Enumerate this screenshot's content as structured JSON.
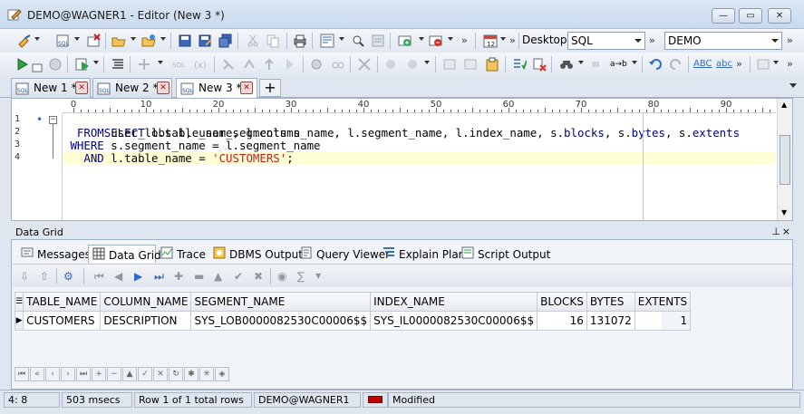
{
  "window": {
    "title": "DEMO@WAGNER1 - Editor (New 3 *)"
  },
  "toolbar": {
    "desktop_label": "Desktop:",
    "desktop_value": "SQL",
    "connection_value": "DEMO",
    "more": "»",
    "bullet": "•",
    "abc_upper": "ABC",
    "abc_lower": "abc",
    "ab": "a→b"
  },
  "tabs": [
    {
      "label": "New 1 *"
    },
    {
      "label": "New 2 *"
    },
    {
      "label": "New 3 *"
    }
  ],
  "add_tab": "+",
  "ruler": {
    "numbers": [
      "0",
      "10",
      "20",
      "30",
      "40",
      "50",
      "60",
      "70",
      "80",
      "90"
    ]
  },
  "editor": {
    "line_numbers": [
      "1",
      "2",
      "3",
      "4"
    ],
    "lines": [
      "SELECT l.table_name, l.column_name, l.segment_name, l.index_name, s.blocks, s.bytes, s.extents",
      "  FROM user_lobs l, user_segments s",
      " WHERE s.segment_name = l.segment_name",
      "   AND l.table_name = 'CUSTOMERS';"
    ]
  },
  "data_grid_panel": {
    "title": "Data Grid",
    "tabs": [
      "Messages",
      "Data Grid",
      "Trace",
      "DBMS Output",
      "Query Viewer",
      "Explain Plan",
      "Script Output"
    ],
    "columns": [
      "TABLE_NAME",
      "COLUMN_NAME",
      "SEGMENT_NAME",
      "INDEX_NAME",
      "BLOCKS",
      "BYTES",
      "EXTENTS"
    ],
    "rows": [
      [
        "CUSTOMERS",
        "DESCRIPTION",
        "SYS_LOB0000082530C00006$$",
        "SYS_IL0000082530C00006$$",
        "16",
        "131072",
        "1"
      ]
    ]
  },
  "statusbar": {
    "position": "4:  8",
    "time": "503 msecs",
    "rows": "Row 1 of 1 total rows",
    "connection": "DEMO@WAGNER1",
    "state": "Modified"
  }
}
